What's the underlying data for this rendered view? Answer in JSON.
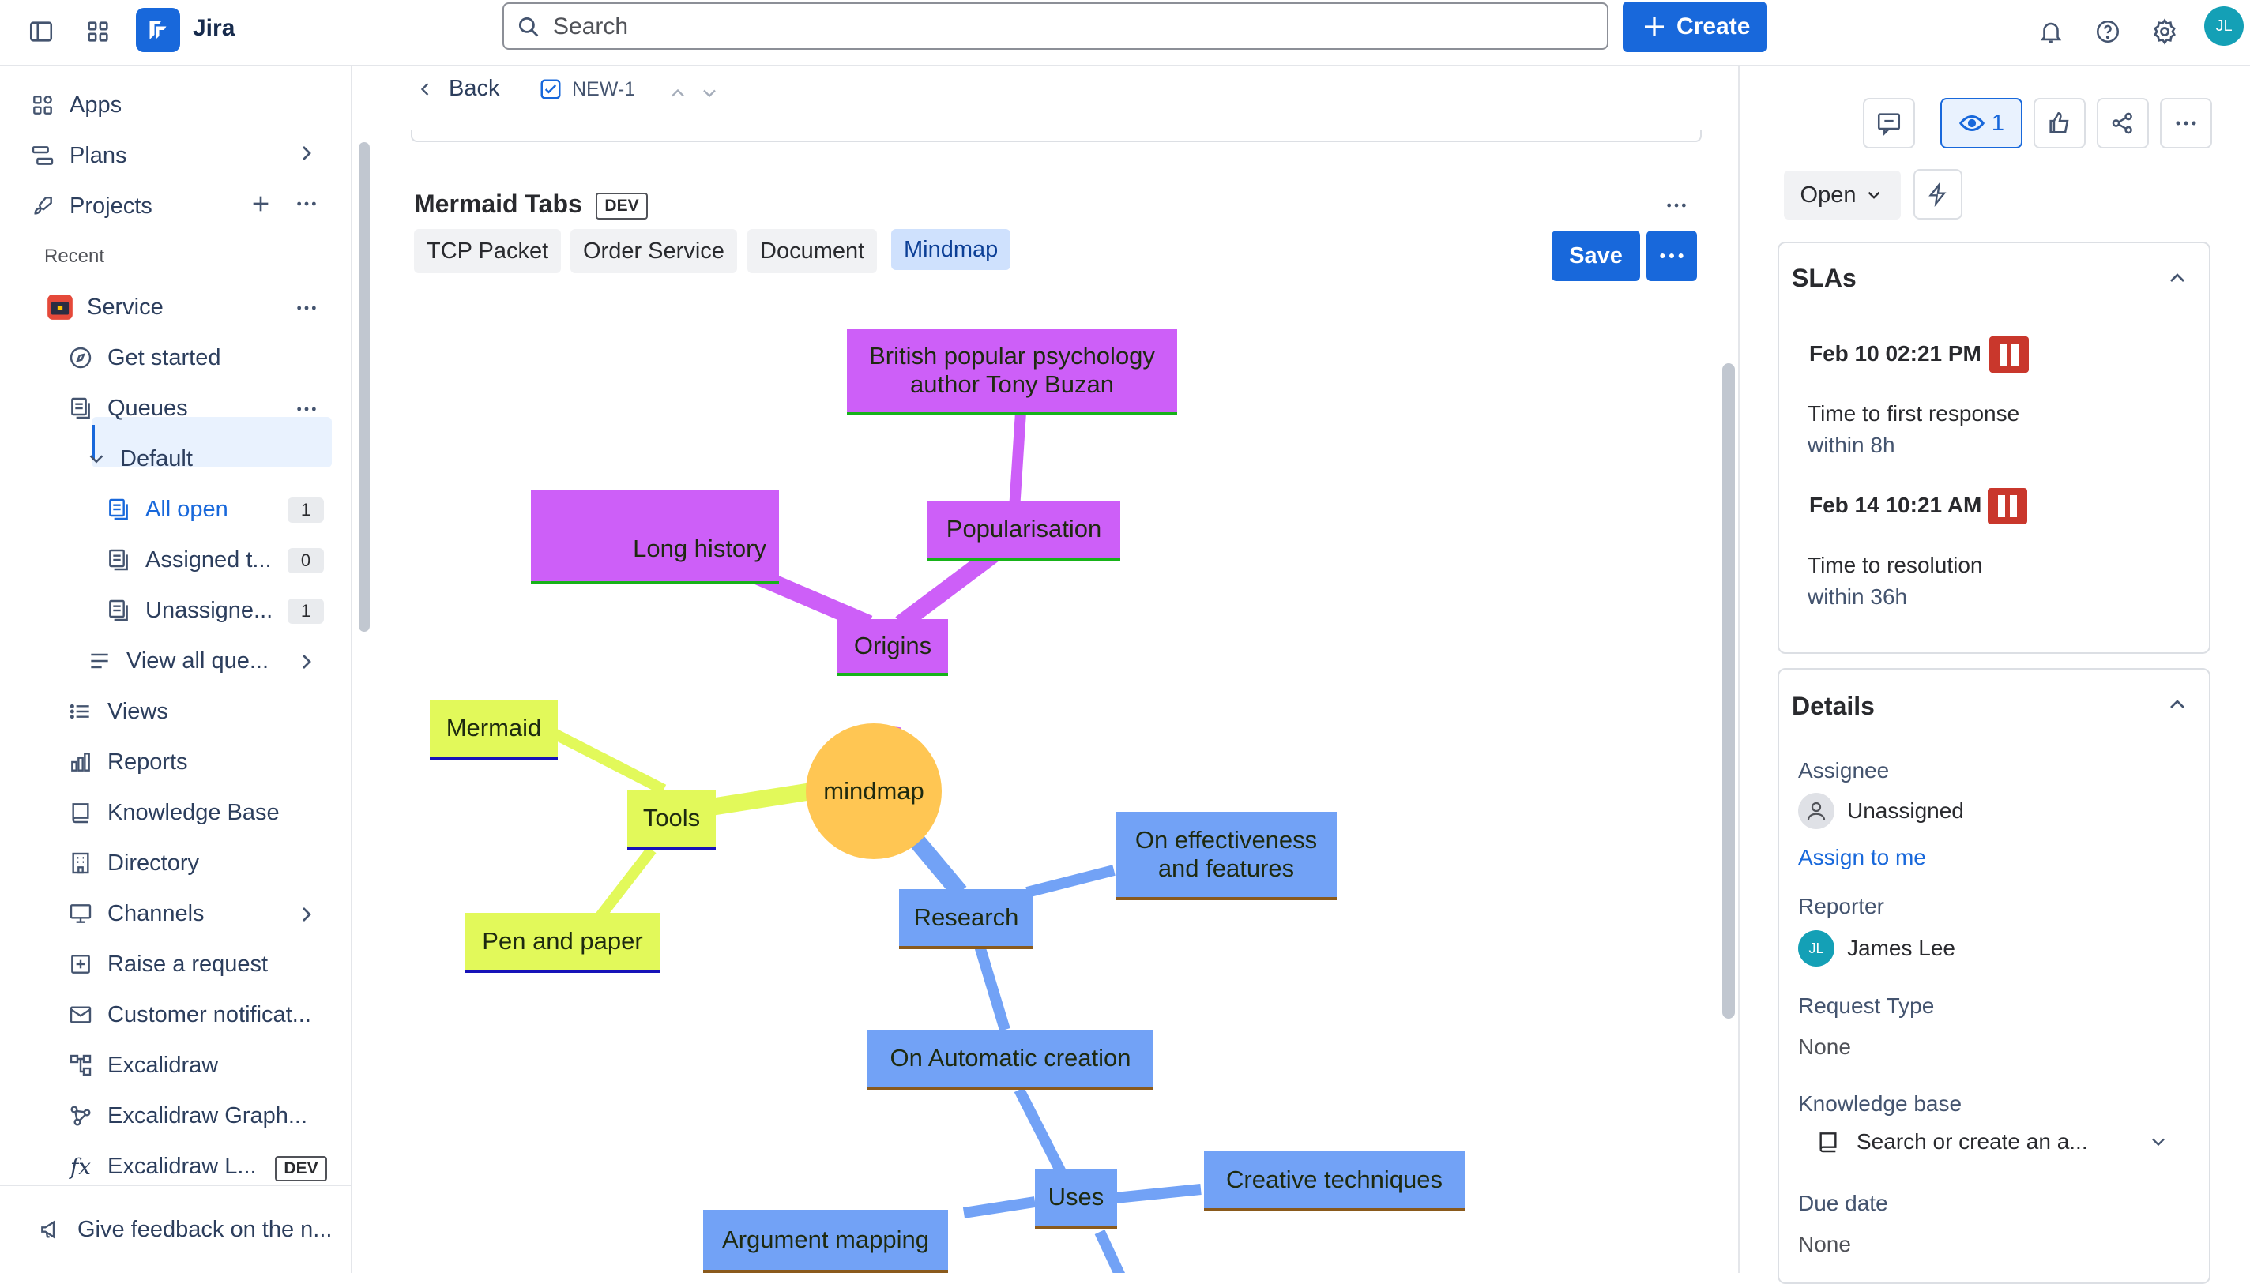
{
  "app": {
    "name": "Jira"
  },
  "search": {
    "placeholder": "Search"
  },
  "topbar": {
    "create_label": "Create",
    "avatar_initials": "JL"
  },
  "sidebar": {
    "apps": "Apps",
    "plans": "Plans",
    "projects": "Projects",
    "recent": "Recent",
    "service": "Service",
    "get_started": "Get started",
    "queues": "Queues",
    "default": "Default",
    "all_open": "All open",
    "all_open_count": "1",
    "assigned": "Assigned t...",
    "assigned_count": "0",
    "unassigned": "Unassigne...",
    "unassigned_count": "1",
    "view_all": "View all que...",
    "views": "Views",
    "reports": "Reports",
    "knowledge_base": "Knowledge Base",
    "directory": "Directory",
    "channels": "Channels",
    "raise_request": "Raise a request",
    "customer_notif": "Customer notificat...",
    "excalidraw": "Excalidraw",
    "excalidraw_graph": "Excalidraw Graph...",
    "excalidraw_l": "Excalidraw L...",
    "dev_badge": "DEV",
    "feedback": "Give feedback on the n..."
  },
  "issue": {
    "back": "Back",
    "key": "NEW-1",
    "panel_title": "Mermaid Tabs",
    "dev_badge": "DEV",
    "tabs": [
      "TCP Packet",
      "Order Service",
      "Document",
      "Mindmap"
    ],
    "active_tab": "Mindmap",
    "save_label": "Save"
  },
  "mindmap": {
    "root": "mindmap",
    "origins": "Origins",
    "long_history": "Long history",
    "popularisation": "Popularisation",
    "buzan_line1": "British popular psychology",
    "buzan_line2": "author Tony Buzan",
    "tools": "Tools",
    "mermaid": "Mermaid",
    "pen_paper": "Pen and paper",
    "research": "Research",
    "effectiveness_line1": "On effectiveness",
    "effectiveness_line2": "and features",
    "automatic": "On Automatic creation",
    "uses": "Uses",
    "creative": "Creative techniques",
    "argument": "Argument mapping",
    "colors": {
      "origins": "#cd5ff8",
      "tools": "#e2f95a",
      "research": "#72a2f6",
      "root": "#ffc653"
    }
  },
  "rightpanel": {
    "watch_count": "1",
    "status": "Open",
    "slas_title": "SLAs",
    "sla1_time": "Feb 10 02:21 PM",
    "sla1_name": "Time to first response",
    "sla1_within": "within 8h",
    "sla2_time": "Feb 14 10:21 AM",
    "sla2_name": "Time to resolution",
    "sla2_within": "within 36h",
    "details_title": "Details",
    "assignee_label": "Assignee",
    "assignee_value": "Unassigned",
    "assign_to_me": "Assign to me",
    "reporter_label": "Reporter",
    "reporter_value": "James Lee",
    "reporter_initials": "JL",
    "request_type_label": "Request Type",
    "request_type_value": "None",
    "kb_label": "Knowledge base",
    "kb_placeholder": "Search or create an a...",
    "due_label": "Due date",
    "due_value": "None"
  }
}
